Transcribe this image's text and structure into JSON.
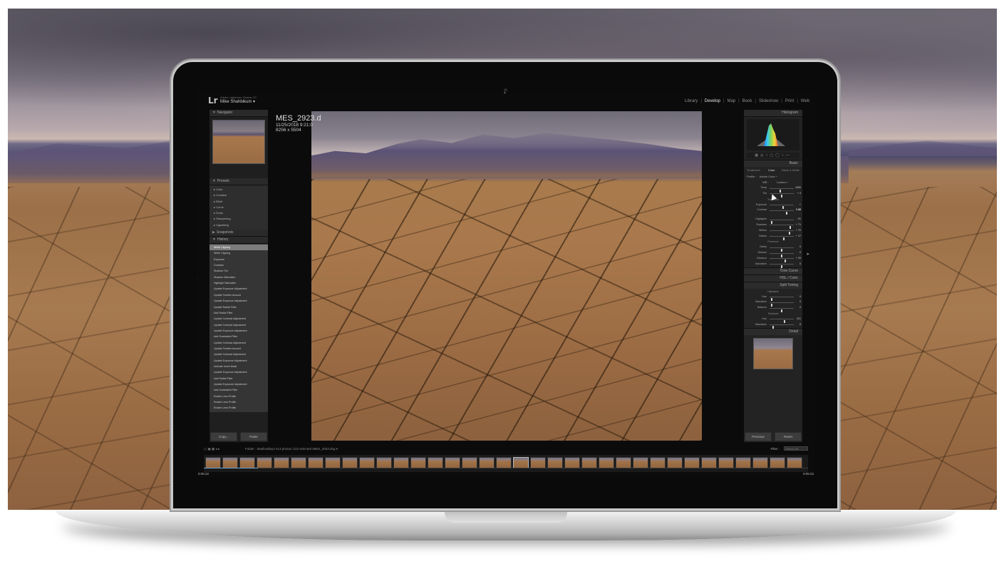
{
  "app": {
    "logo": "Lr",
    "product": "Adobe Lightroom Classic CC",
    "user": "Mike Shahbikum ▾"
  },
  "modules": [
    "Library",
    "Develop",
    "Map",
    "Book",
    "Slideshow",
    "Print",
    "Web"
  ],
  "active_module": "Develop",
  "image_info": {
    "filename": "MES_2923.d",
    "date": "11/25/2018 9:21:0",
    "dimensions": "8256 x 5504"
  },
  "left_panel": {
    "navigator_label": "Navigator",
    "presets_label": "Presets",
    "presets": [
      "▸ Color",
      "▸ Creative",
      "▸ B&W",
      "",
      "▸ Curve",
      "▸ Grain",
      "▸ Sharpening",
      "▸ Vignetting"
    ],
    "snapshots_label": "Snapshots",
    "history_label": "History",
    "history": [
      "White Clipping",
      "White Clipping",
      "Exposure",
      "Contrast",
      "Shadow Tint",
      "Shadow Saturation",
      "Highlight Saturation",
      "Update Exposure Adjustment",
      "Update Feather Amount",
      "Update Exposure Adjustment",
      "Update Radial Filter",
      "Add Radial Filter",
      "Update Contrast Adjustment",
      "Update Contrast Adjustment",
      "Update Exposure Adjustment",
      "Add Graduated Filter",
      "Update Contrast Adjustment",
      "Update Feather Amount",
      "Update Contrast Adjustment",
      "Update Exposure Adjustment",
      "Activate Invert Mask",
      "Update Exposure Adjustment",
      "Add Radial Filter",
      "Update Exposure Adjustment",
      "Add Graduated Filter",
      "Enable Lens Profile",
      "Enable Lens Profile",
      "Enable Lens Profile"
    ],
    "copy_button": "Copy...",
    "paste_button": "Paste"
  },
  "right_panel": {
    "histogram_label": "Histogram",
    "basic_label": "Basic",
    "treatment_label": "Treatment :",
    "treatment_color": "Color",
    "treatment_bw": "Black & White",
    "profile_label": "Profile :",
    "profile_value": "Adobe Color ÷",
    "wb_label": "WB :",
    "wb_value": "Custom ÷",
    "wb_sliders": [
      {
        "label": "Temp",
        "value": "4350",
        "pos": 0.45
      },
      {
        "label": "Tint",
        "value": "+ 4",
        "pos": 0.5
      }
    ],
    "tone_label": "Tone",
    "tone_auto": "Auto",
    "tone_sliders": [
      {
        "label": "Exposure",
        "value": "+ 0.50",
        "pos": 0.55
      },
      {
        "label": "Contrast",
        "value": "+ 48",
        "pos": 0.72
      }
    ],
    "tone_sliders_2": [
      {
        "label": "Highlights",
        "value": "- 91",
        "pos": 0.1
      },
      {
        "label": "Shadows",
        "value": "+ 71",
        "pos": 0.85
      },
      {
        "label": "Whites",
        "value": "+ 70",
        "pos": 0.83
      },
      {
        "label": "Blacks",
        "value": "+ 17",
        "pos": 0.58
      }
    ],
    "presence_label": "Presence",
    "presence_sliders": [
      {
        "label": "Clarity",
        "value": "0",
        "pos": 0.5
      },
      {
        "label": "Dehaze",
        "value": "0",
        "pos": 0.5
      },
      {
        "label": "Vibrance",
        "value": "+ 29",
        "pos": 0.64
      },
      {
        "label": "Saturation",
        "value": "0",
        "pos": 0.5
      }
    ],
    "tone_curve_label": "Tone Curve",
    "hsl_label": "HSL / Color",
    "split_toning_label": "Split Toning",
    "highlights_group": "Highlights",
    "split_hl_sliders": [
      {
        "label": "Hue",
        "value": "0",
        "pos": 0.1
      },
      {
        "label": "Saturation",
        "value": "0",
        "pos": 0.1
      }
    ],
    "balance_slider": {
      "label": "Balance",
      "value": "0",
      "pos": 0.5
    },
    "shadows_group": "Shadows",
    "split_sh_sliders": [
      {
        "label": "Hue",
        "value": "221",
        "pos": 0.62
      },
      {
        "label": "Saturation",
        "value": "5",
        "pos": 0.14
      }
    ],
    "detail_label": "Detail",
    "previous_button": "Previous",
    "reset_button": "Reset"
  },
  "toolbar": {
    "source_path": "Folder : deathvalley3",
    "photo_count": "413 photos /113 selected /MES_2923.dng ▾",
    "filter_label": "Filter :",
    "filter_value": "Filters Off"
  },
  "filmstrip": {
    "count": 35,
    "selected_index": 18
  },
  "timeline": {
    "start": "0:05:22",
    "end": "0:05:22",
    "progress": 0.09
  },
  "colors": {
    "accent": "#6aa8d8",
    "panel_bg": "#1f1f1f",
    "history_selected": "#7c7c7c"
  }
}
